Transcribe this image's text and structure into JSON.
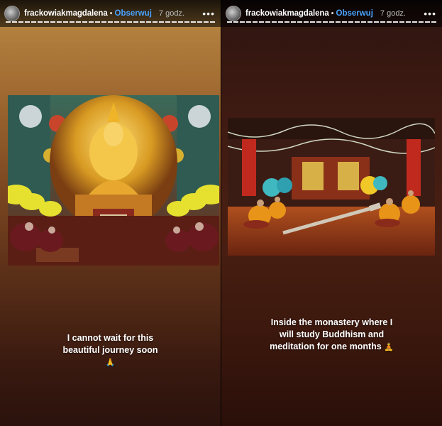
{
  "stories": [
    {
      "username": "frackowiakmagdalena",
      "separator": "•",
      "follow_label": "Obserwuj",
      "time_ago": "7 godz.",
      "more_icon": "more-horizontal-icon",
      "more_label": "•••",
      "caption_line1": "I cannot wait for this",
      "caption_line2": "beautiful journey soon",
      "caption_emoji": "🙏"
    },
    {
      "username": "frackowiakmagdalena",
      "separator": "•",
      "follow_label": "Obserwuj",
      "time_ago": "7 godz.",
      "more_icon": "more-horizontal-icon",
      "more_label": "•••",
      "caption_line1": "Inside the monastery where I",
      "caption_line2": "will study Buddhism and",
      "caption_line3": "meditation for one months",
      "caption_emoji": "🧘"
    }
  ],
  "colors": {
    "follow": "#4aa3ff",
    "left_top": "#b98a45",
    "left_bottom": "#2a120c",
    "right_top": "#2e1410",
    "right_bottom": "#2a0f09"
  }
}
